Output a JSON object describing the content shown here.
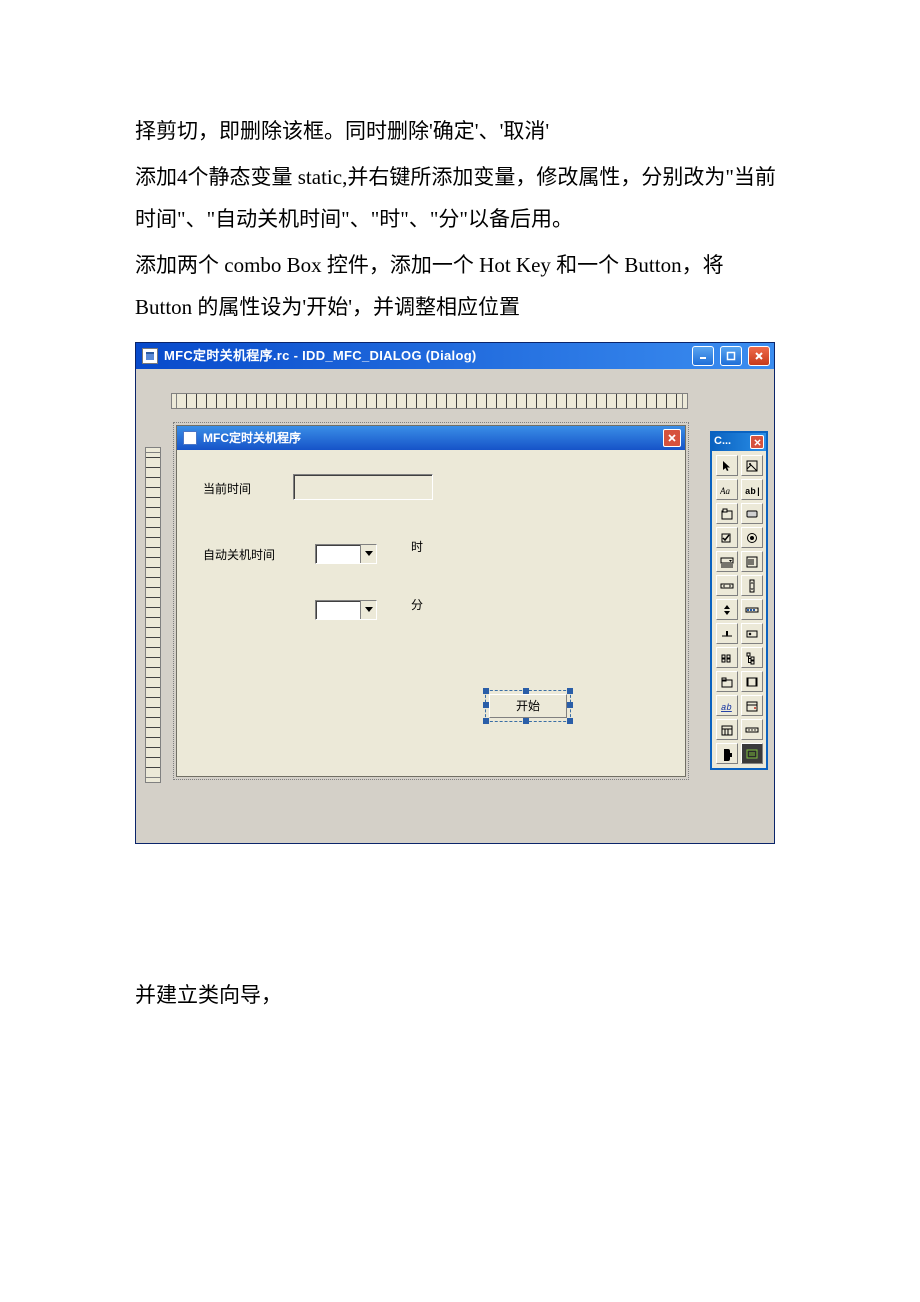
{
  "paragraphs": {
    "p1": "择剪切，即删除该框。同时删除'确定'、'取消'",
    "p2": "添加4个静态变量 static,并右键所添加变量，修改属性，分别改为\"当前时间\"、\"自动关机时间\"、\"时\"、\"分\"以备后用。",
    "p3": "添加两个 combo Box 控件，添加一个 Hot Key 和一个 Button，将 Button 的属性设为'开始'，并调整相应位置",
    "p4": "并建立类向导，"
  },
  "ide": {
    "title": "MFC定时关机程序.rc - IDD_MFC_DIALOG (Dialog)"
  },
  "dialog": {
    "title": "MFC定时关机程序",
    "labels": {
      "current_time": "当前时间",
      "shutdown_time": "自动关机时间",
      "hour": "时",
      "minute": "分"
    },
    "button_start": "开始"
  },
  "toolbox": {
    "title": "C..."
  }
}
